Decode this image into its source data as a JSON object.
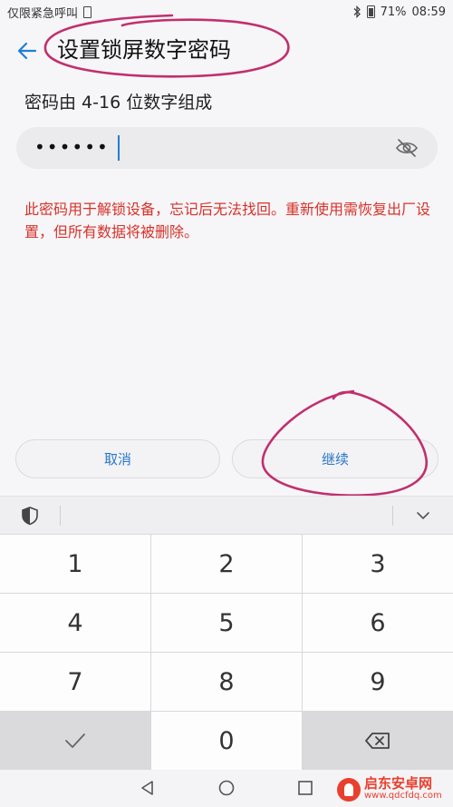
{
  "status": {
    "carrier": "仅限紧急呼叫",
    "battery": "71%",
    "time": "08:59"
  },
  "header": {
    "title": "设置锁屏数字密码"
  },
  "password": {
    "hint": "密码由 4-16 位数字组成",
    "masked": "••••••"
  },
  "warning": "此密码用于解锁设备，忘记后无法找回。重新使用需恢复出厂设置，但所有数据将被删除。",
  "actions": {
    "cancel": "取消",
    "continue": "继续"
  },
  "keypad": {
    "keys": [
      "1",
      "2",
      "3",
      "4",
      "5",
      "6",
      "7",
      "8",
      "9",
      "0"
    ]
  },
  "watermark": {
    "title": "启东安卓网",
    "url": "www.qdcfdq.com"
  },
  "colors": {
    "accent": "#1e7fd6",
    "warning": "#d6332a",
    "annotation": "#c0306e"
  }
}
